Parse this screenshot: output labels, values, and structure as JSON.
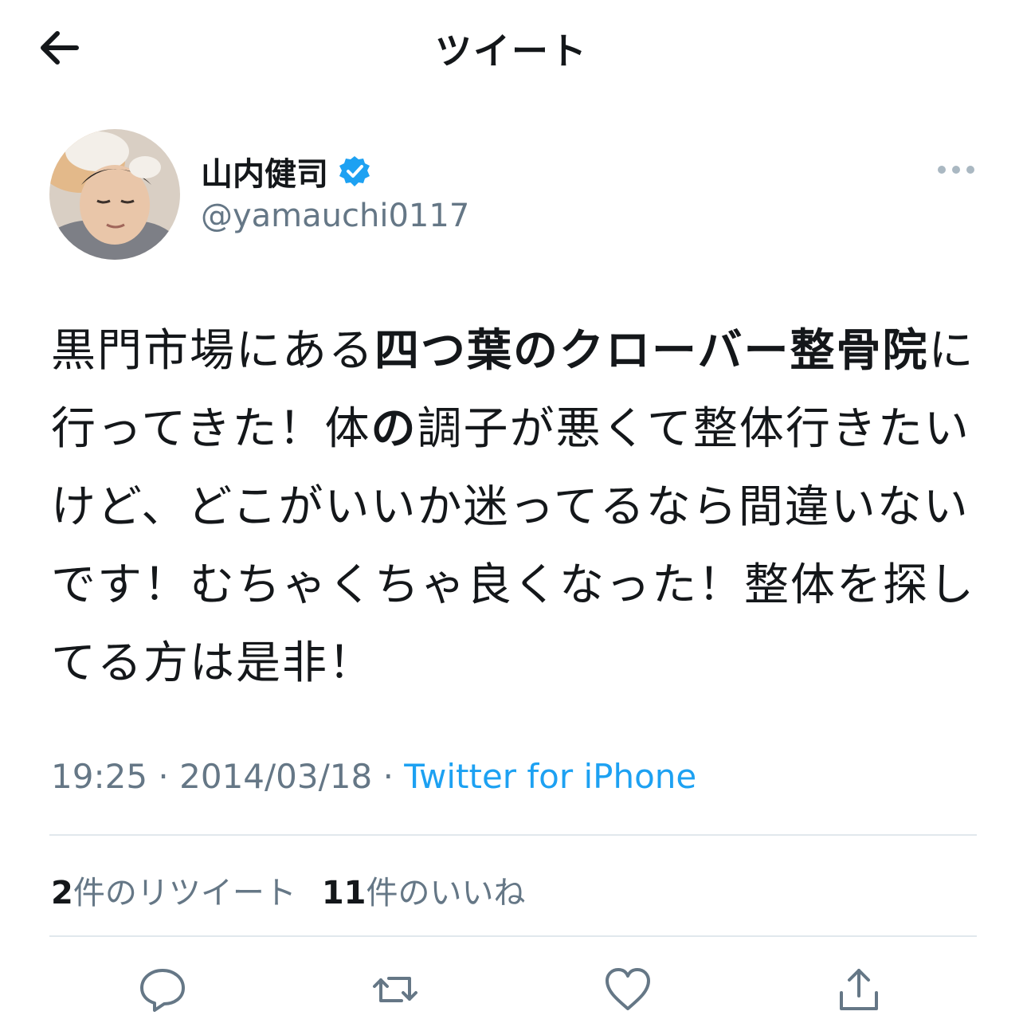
{
  "header": {
    "title": "ツイート",
    "back_icon": "arrow-left-icon"
  },
  "user": {
    "display_name": "山内健司",
    "handle": "@yamauchi0117",
    "verified_icon": "verified-badge-icon",
    "verified_color": "#1da1f2"
  },
  "tweet": {
    "segments": [
      {
        "text": "黒門市場にある",
        "bold": false
      },
      {
        "text": "四つ葉のクローバー整骨院",
        "bold": true
      },
      {
        "text": "に行ってきた！体",
        "bold": false
      },
      {
        "text": "の",
        "bold": true
      },
      {
        "text": "調子が悪くて整体行きたいけど、どこがいいか迷ってるなら間違いないです！むちゃくちゃ良くなった！整体を探してる方は是非！",
        "bold": false
      }
    ]
  },
  "meta": {
    "time": "19:25",
    "date": "2014/03/18",
    "separator": "·",
    "source": "Twitter for iPhone"
  },
  "stats": {
    "retweets_count": "2",
    "retweets_label": "件のリツイート",
    "likes_count": "11",
    "likes_label": "件のいいね"
  },
  "actions": {
    "icons": [
      "reply-icon",
      "retweet-icon",
      "like-icon",
      "share-icon"
    ]
  },
  "colors": {
    "text": "#14171a",
    "secondary": "#657786",
    "accent": "#1da1f2",
    "divider": "#e1e8ed"
  }
}
